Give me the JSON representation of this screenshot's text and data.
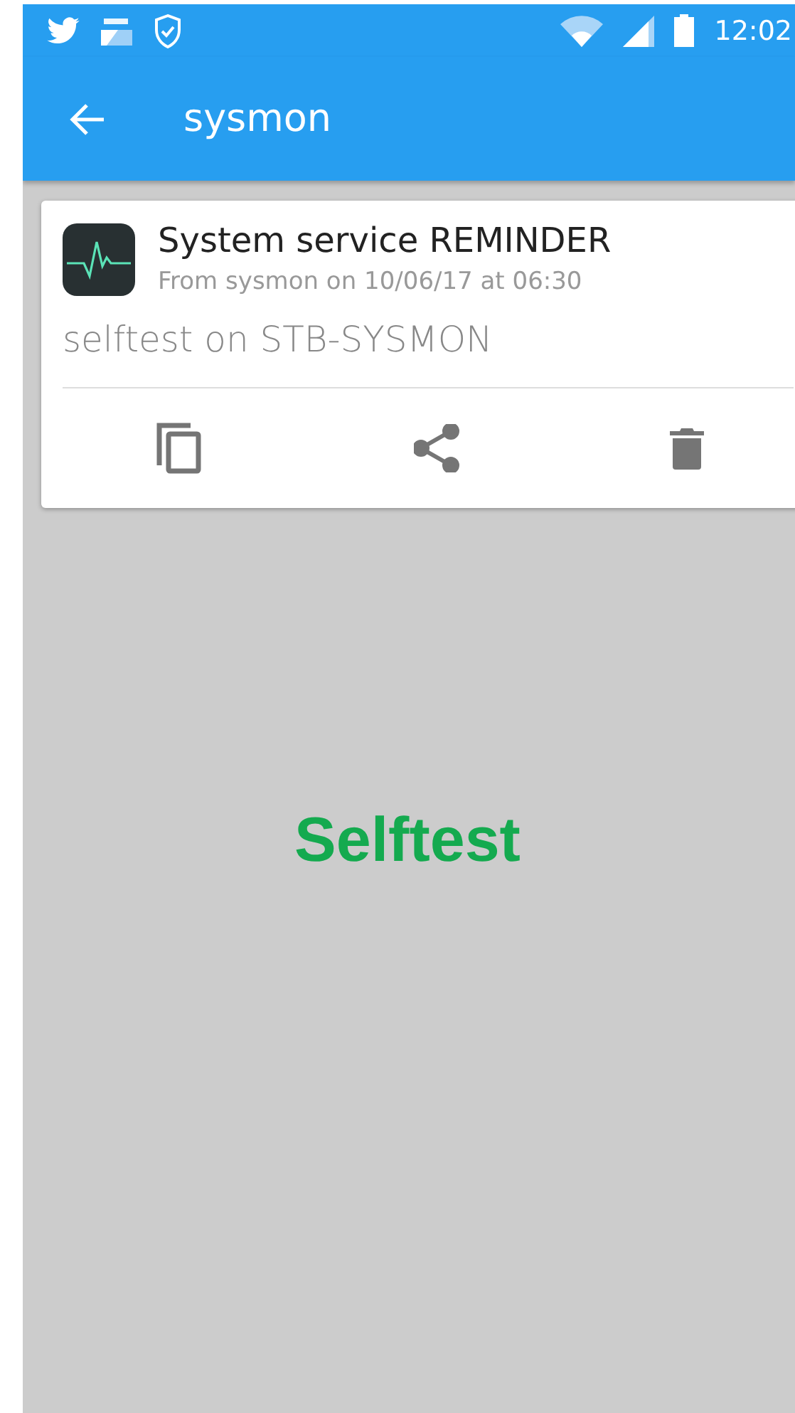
{
  "status_bar": {
    "time": "12:02"
  },
  "app_bar": {
    "title": "sysmon"
  },
  "message": {
    "title": "System service REMINDER",
    "meta": "From sysmon on 10/06/17 at 06:30",
    "body": "selftest on STB-SYSMON",
    "actions": [
      {
        "kind": "copy"
      },
      {
        "kind": "share"
      },
      {
        "kind": "delete"
      }
    ]
  },
  "center_text": "Selftest"
}
